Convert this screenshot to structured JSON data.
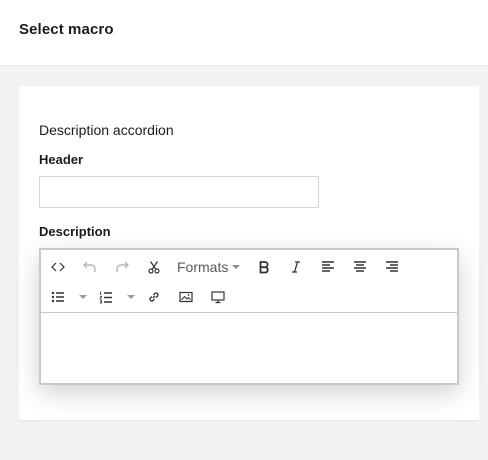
{
  "header": {
    "title": "Select macro"
  },
  "form": {
    "section_title": "Description accordion",
    "header_label": "Header",
    "header_value": "",
    "header_placeholder": "",
    "description_label": "Description",
    "description_value": ""
  },
  "editor_toolbar": {
    "row1": [
      "source-code",
      "undo",
      "redo",
      "cut",
      "formats",
      "bold",
      "italic",
      "align-left",
      "align-center",
      "align-right"
    ],
    "row2": [
      "bullet-list",
      "bullet-list-options",
      "numbered-list",
      "numbered-list-options",
      "link",
      "image",
      "embed-media"
    ],
    "formats_label": "Formats"
  },
  "colors": {
    "page_bg": "#f3f2f2",
    "card_bg": "#ffffff",
    "border": "#c9c9cb",
    "text": "#1b1b1b"
  }
}
